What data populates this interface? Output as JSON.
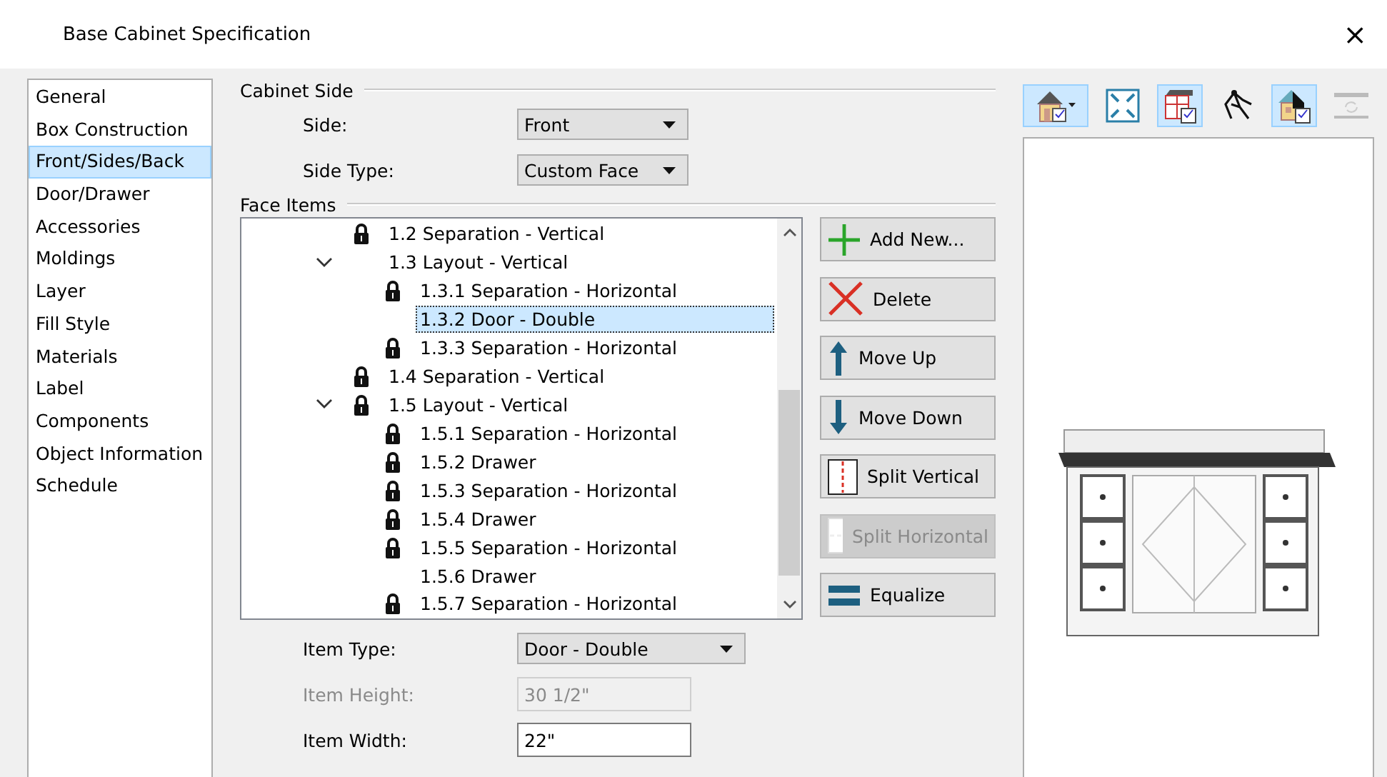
{
  "window": {
    "title": "Base Cabinet Specification",
    "close": "×"
  },
  "nav": [
    {
      "label": "General",
      "selected": false
    },
    {
      "label": "Box Construction",
      "selected": false
    },
    {
      "label": "Front/Sides/Back",
      "selected": true
    },
    {
      "label": "Door/Drawer",
      "selected": false
    },
    {
      "label": "Accessories",
      "selected": false
    },
    {
      "label": "Moldings",
      "selected": false
    },
    {
      "label": "Layer",
      "selected": false
    },
    {
      "label": "Fill Style",
      "selected": false
    },
    {
      "label": "Materials",
      "selected": false
    },
    {
      "label": "Label",
      "selected": false
    },
    {
      "label": "Components",
      "selected": false
    },
    {
      "label": "Object Information",
      "selected": false
    },
    {
      "label": "Schedule",
      "selected": false
    }
  ],
  "cabinet_side": {
    "legend": "Cabinet Side",
    "fields": [
      {
        "label": "Side:",
        "value": "Front"
      },
      {
        "label": "Side Type:",
        "value": "Custom Face"
      }
    ]
  },
  "face_items": {
    "legend": "Face Items",
    "tree": [
      {
        "label": "1.2 Separation - Vertical",
        "locked": true,
        "selected": false
      },
      {
        "label": "1.3 Layout - Vertical",
        "locked": false,
        "selected": false,
        "expanded": true,
        "children": [
          {
            "label": "1.3.1 Separation - Horizontal",
            "locked": true,
            "selected": false
          },
          {
            "label": "1.3.2 Door - Double",
            "locked": false,
            "selected": true
          },
          {
            "label": "1.3.3 Separation - Horizontal",
            "locked": true,
            "selected": false
          }
        ]
      },
      {
        "label": "1.4 Separation - Vertical",
        "locked": true,
        "selected": false
      },
      {
        "label": "1.5 Layout - Vertical",
        "locked": true,
        "selected": false,
        "expanded": true,
        "children": [
          {
            "label": "1.5.1 Separation - Horizontal",
            "locked": true,
            "selected": false
          },
          {
            "label": "1.5.2 Drawer",
            "locked": true,
            "selected": false
          },
          {
            "label": "1.5.3 Separation - Horizontal",
            "locked": true,
            "selected": false
          },
          {
            "label": "1.5.4 Drawer",
            "locked": true,
            "selected": false
          },
          {
            "label": "1.5.5 Separation - Horizontal",
            "locked": true,
            "selected": false
          },
          {
            "label": "1.5.6 Drawer",
            "locked": false,
            "selected": false
          },
          {
            "label": "1.5.7 Separation - Horizontal",
            "locked": true,
            "selected": false
          }
        ]
      }
    ],
    "buttons": [
      {
        "kind": "add",
        "label": "Add New...",
        "disabled": false
      },
      {
        "kind": "delete",
        "label": "Delete",
        "disabled": false
      },
      {
        "kind": "up",
        "label": "Move Up",
        "disabled": false
      },
      {
        "kind": "down",
        "label": "Move Down",
        "disabled": false
      },
      {
        "kind": "splitv",
        "label": "Split Vertical",
        "disabled": false
      },
      {
        "kind": "splith",
        "label": "Split Horizontal",
        "disabled": true
      },
      {
        "kind": "equalize",
        "label": "Equalize",
        "disabled": false
      }
    ]
  },
  "item_fields": [
    {
      "kind": "select",
      "label": "Item Type:",
      "value": "Door - Double",
      "disabled": false
    },
    {
      "kind": "input",
      "label": "Item Height:",
      "value": "30 1/2\"",
      "disabled": true
    },
    {
      "kind": "input",
      "label": "Item Width:",
      "value": "22\"",
      "disabled": false
    }
  ],
  "preview_toolbar": [
    {
      "kind": "house",
      "selected": true
    },
    {
      "kind": "fit",
      "selected": false
    },
    {
      "kind": "cabinet",
      "selected": true
    },
    {
      "kind": "tool",
      "selected": false
    },
    {
      "kind": "house2",
      "selected": true
    },
    {
      "kind": "disabled",
      "selected": false
    }
  ]
}
